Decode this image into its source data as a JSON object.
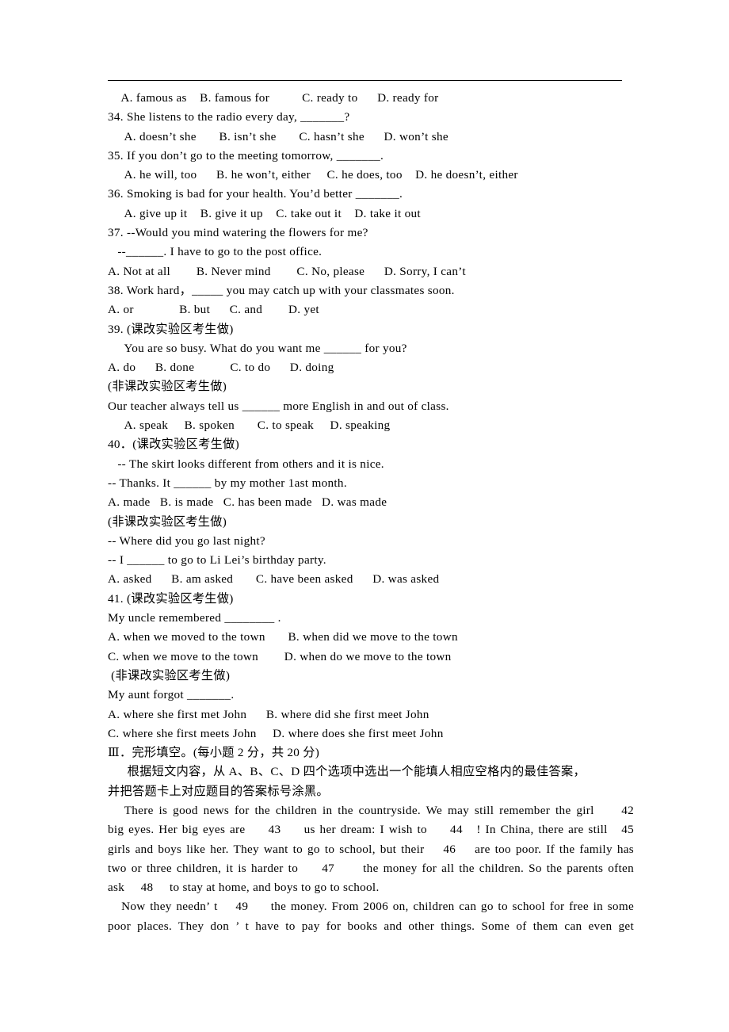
{
  "document": {
    "type": "exam-paper",
    "language": "English/Chinese",
    "header_rule": true
  },
  "lines": {
    "l01_q33_options": "    A. famous as    B. famous for          C. ready to      D. ready for",
    "l02_q34_stem": "34. She listens to the radio every day, _______?",
    "l03_q34_options": "     A. doesn’t she       B. isn’t she       C. hasn’t she      D. won’t she",
    "l04_q35_stem": "35. If you don’t go to the meeting tomorrow, _______.",
    "l05_q35_options": "     A. he will, too      B. he won’t, either     C. he does, too    D. he doesn’t, either",
    "l06_q36_stem": "36. Smoking is bad for your health. You’d better _______.",
    "l07_q36_options": "     A. give up it    B. give it up    C. take out it    D. take it out",
    "l08_q37_stem": "37. --Would you mind watering the flowers for me?",
    "l09_q37_reply": "   --______. I have to go to the post office.",
    "l10_q37_options": "A. Not at all        B. Never mind        C. No, please      D. Sorry, I can’t",
    "l11_q38_stem": "38. Work hard，_____ you may catch up with your classmates soon.",
    "l12_q38_options": "A. or              B. but      C. and        D. yet",
    "l13_q39_tag": "39. (课改实验区考生做)",
    "l14_q39_stem": "     You are so busy. What do you want me ______ for you?",
    "l15_q39_options": "A. do      B. done           C. to do      D. doing",
    "l16_q39_tag_b": "(非课改实验区考生做)",
    "l17_q39b_stem": "Our teacher always tell us ______ more English in and out of class.",
    "l18_q39b_options": "     A. speak     B. spoken       C. to speak     D. speaking",
    "l19_q40_tag": "40．(课改实验区考生做)",
    "l20_q40_line1": "   -- The skirt looks different from others and it is nice.",
    "l21_q40_line2": "-- Thanks. It ______ by my mother 1ast month.",
    "l22_q40_options": "A. made   B. is made   C. has been made   D. was made",
    "l23_q40_tag_b": "(非课改实验区考生做)",
    "l24_q40b_line1": "-- Where did you go last night?",
    "l25_q40b_line2": "-- I ______ to go to Li Lei’s birthday party.",
    "l26_q40b_options": "A. asked      B. am asked       C. have been asked      D. was asked",
    "l27_q41_tag": "41. (课改实验区考生做)",
    "l28_q41_stem": "My uncle remembered ________ .",
    "l29_q41_opt_ab": "A. when we moved to the town       B. when did we move to the town",
    "l30_q41_opt_cd": "C. when we move to the town        D. when do we move to the town",
    "l31_q41_tag_b": " (非课改实验区考生做)",
    "l32_q41b_stem": "My aunt forgot _______.",
    "l33_q41b_opt_ab": "A. where she first met John      B. where did she first meet John",
    "l34_q41b_opt_cd": "C. where she first meets John     D. where does she first meet John",
    "l35_section3_title": "Ⅲ．完形填空。(每小题 2 分，共 20 分)",
    "l36_section3_dir1": "      根据短文内容，从 A、B、C、D 四个选项中选出一个能填人相应空格内的最佳答案，",
    "l37_section3_dir2": "并把答题卡上对应题目的答案标号涂黑。",
    "p1_line1": "   There is good news for the children in the countryside. We may still remember the girl     42",
    "p1_line2": "big eyes. Her big eyes are     43     us her dream: I wish to     44   ! In China, there are still   45",
    "p1_line3": "girls and boys like her. They want to go to school, but their    46    are too poor. If the family has",
    "p1_line4": "two or three children, it is harder to     47      the money for all the children. So the parents often",
    "p1_line5": "ask     48     to stay at home, and boys to go to school.",
    "p2_line1": "   Now they needn’ t    49     the money. From 2006 on, children can go to school for free in some",
    "p2_line2": "poor places. They don ’ t have to pay for books and other things. Some of them can even get"
  }
}
